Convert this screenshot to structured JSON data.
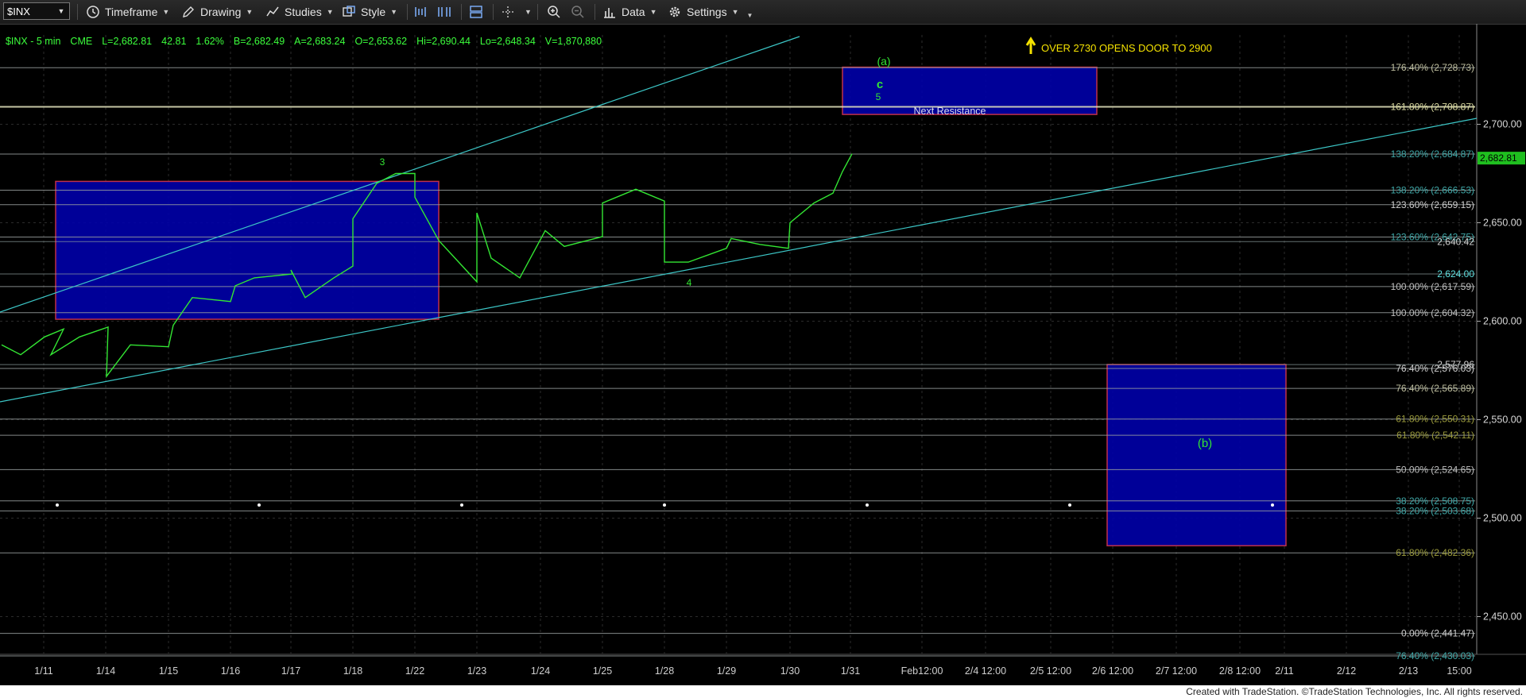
{
  "toolbar": {
    "symbol": "$INX",
    "items": [
      {
        "label": "Timeframe",
        "icon": "clock-icon"
      },
      {
        "label": "Drawing",
        "icon": "pencil-icon"
      },
      {
        "label": "Studies",
        "icon": "studies-icon"
      },
      {
        "label": "Style",
        "icon": "style-icon"
      },
      {
        "label": "Data",
        "icon": "bar-chart-icon"
      },
      {
        "label": "Settings",
        "icon": "gear-icon"
      }
    ]
  },
  "quote": {
    "symbol": "$INX - 5 min",
    "exchange": "CME",
    "last": "L=2,682.81",
    "change": "42.81",
    "pct": "1.62%",
    "bid": "B=2,682.49",
    "ask": "A=2,683.24",
    "open": "O=2,653.62",
    "high": "Hi=2,690.44",
    "low": "Lo=2,648.34",
    "volume": "V=1,870,880"
  },
  "footer": "Created with TradeStation. ©TradeStation Technologies, Inc. All rights reserved.",
  "colors": {
    "price": "#33e633",
    "trendline": "#3cc7c7",
    "box_fill": "#0000a8",
    "box_border": "#c0304a",
    "fib_teal": "#3a8f8f",
    "fib_olive": "#9b9b3c",
    "annotation_yellow": "#f5e200"
  },
  "chart_data": {
    "type": "line",
    "title": "$INX - 5 min",
    "ylim": [
      2425,
      2760
    ],
    "y_ticks": [
      2450,
      2500,
      2550,
      2600,
      2650,
      2700
    ],
    "y_tick_labels": [
      "2,450.00",
      "2,500.00",
      "2,550.00",
      "2,600.00",
      "2,650.00",
      "2,700.00"
    ],
    "x_tick_labels": [
      "1/11",
      "1/14",
      "1/15",
      "1/16",
      "1/17",
      "1/18",
      "1/22",
      "1/23",
      "1/24",
      "1/25",
      "1/28",
      "1/29",
      "1/30",
      "1/31",
      "Feb12:00",
      "2/4 12:00",
      "2/5 12:00",
      "2/6 12:00",
      "2/7 12:00",
      "2/8 12:00",
      "2/11",
      "2/12",
      "2/13",
      "15:00"
    ],
    "grid": true,
    "last_price_label": "2,682.81",
    "last_price": 2682.81,
    "series": [
      {
        "x": [
          "1/10 09:30",
          "1/10 11:30",
          "1/10 14:00",
          "1/10 16:00",
          "1/11 10:00",
          "1/11 13:00",
          "1/11 16:00",
          "1/14 09:30",
          "1/14 12:00",
          "1/14 16:00",
          "1/15 10:00",
          "1/15 12:00",
          "1/15 16:00",
          "1/16 10:00",
          "1/16 12:00",
          "1/16 16:00",
          "1/17 09:30",
          "1/17 11:00",
          "1/17 14:00",
          "1/17 16:00",
          "1/18 09:30",
          "1/18 12:00",
          "1/18 14:00",
          "1/18 16:00",
          "1/22 09:30",
          "1/22 12:00",
          "1/22 16:00",
          "1/23 09:30",
          "1/23 11:00",
          "1/23 14:00",
          "1/23 16:00",
          "1/24 10:00",
          "1/24 12:00",
          "1/24 16:00",
          "1/25 09:30",
          "1/25 13:00",
          "1/25 16:00",
          "1/28 09:30",
          "1/28 12:00",
          "1/28 16:00",
          "1/29 10:00",
          "1/29 13:00",
          "1/29 16:00",
          "1/30 09:30",
          "1/30 12:00",
          "1/30 14:00",
          "1/30 15:00",
          "1/30 16:00"
        ],
        "values": [
          2588,
          2583,
          2592,
          2596,
          2583,
          2592,
          2597,
          2572,
          2588,
          2587,
          2598,
          2612,
          2610,
          2618,
          2622,
          2624,
          2626,
          2612,
          2622,
          2628,
          2652,
          2670,
          2675,
          2675,
          2663,
          2641,
          2620,
          2655,
          2632,
          2622,
          2640,
          2646,
          2638,
          2643,
          2660,
          2667,
          2661,
          2630,
          2630,
          2637,
          2642,
          2639,
          2637,
          2650,
          2660,
          2665,
          2676,
          2685
        ]
      }
    ],
    "fib_levels": [
      {
        "label": "176.40% (2,728.73)",
        "value": 2728.73
      },
      {
        "label": "161.80% (2,708.87)",
        "value": 2708.87
      },
      {
        "label": "138.20% (2,684.87)",
        "value": 2684.87
      },
      {
        "label": "138.20% (2,666.53)",
        "value": 2666.53
      },
      {
        "label": "123.60% (2,659.15)",
        "value": 2659.15
      },
      {
        "label": "123.60% (2,642.75)",
        "value": 2642.75
      },
      {
        "label": "100.00% (2,617.59)",
        "value": 2617.59
      },
      {
        "label": "100.00% (2,604.32)",
        "value": 2604.32
      },
      {
        "label": "76.40% (2,576.03)",
        "value": 2576.03
      },
      {
        "label": "76.40% (2,565.89)",
        "value": 2565.89
      },
      {
        "label": "61.80% (2,550.31)",
        "value": 2550.31
      },
      {
        "label": "61.80% (2,542.11)",
        "value": 2542.11
      },
      {
        "label": "50.00% (2,524.65)",
        "value": 2524.65
      },
      {
        "label": "38.20% (2,508.75)",
        "value": 2508.75
      },
      {
        "label": "38.20% (2,503.68)",
        "value": 2503.68
      },
      {
        "label": "61.80% (2,482.36)",
        "value": 2482.36
      },
      {
        "label": "0.00% (2,441.47)",
        "value": 2441.47
      },
      {
        "label": "76.40% (2,430.03)",
        "value": 2430.03
      }
    ],
    "price_level_labels": [
      {
        "label": "2,640.42",
        "value": 2640.42
      },
      {
        "label": "2,624.00",
        "value": 2624.0
      },
      {
        "label": "2,577.96",
        "value": 2577.96
      }
    ],
    "annotations": [
      {
        "text": "OVER 2730 OPENS DOOR TO 2900"
      },
      {
        "text": "Next Resistance"
      },
      {
        "text": "(a)"
      },
      {
        "text": "c"
      },
      {
        "text": "5"
      },
      {
        "text": "3"
      },
      {
        "text": "4"
      },
      {
        "text": "(b)"
      }
    ],
    "target_boxes": [
      {
        "name": "consolidation zone",
        "y_range": [
          2601,
          2671
        ]
      },
      {
        "name": "next resistance",
        "label": "Next Resistance",
        "y_range": [
          2705,
          2729
        ]
      },
      {
        "name": "(b) target",
        "label": "(b)",
        "y_range": [
          2486,
          2578
        ]
      }
    ]
  }
}
